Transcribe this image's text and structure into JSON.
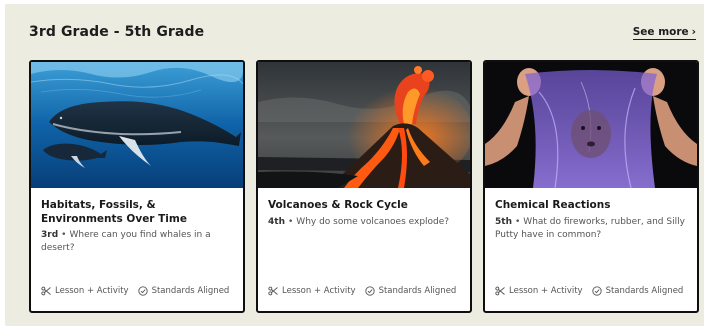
{
  "section": {
    "title": "3rd Grade - 5th Grade",
    "see_more_label": "See more",
    "see_more_icon": "chevron-right-icon"
  },
  "cards": [
    {
      "title": "Habitats, Fossils, & Environments Over Time",
      "grade": "3rd",
      "question": "Where can you find whales in a desert?",
      "image": "humpback-whales-underwater",
      "tags": [
        {
          "icon": "scissors-icon",
          "label": "Lesson + Activity"
        },
        {
          "icon": "check-circle-icon",
          "label": "Standards Aligned"
        }
      ]
    },
    {
      "title": "Volcanoes & Rock Cycle",
      "grade": "4th",
      "question": "Why do some volcanoes explode?",
      "image": "erupting-volcano",
      "tags": [
        {
          "icon": "scissors-icon",
          "label": "Lesson + Activity"
        },
        {
          "icon": "check-circle-icon",
          "label": "Standards Aligned"
        }
      ]
    },
    {
      "title": "Chemical Reactions",
      "grade": "5th",
      "question": "What do fireworks, rubber, and Silly Putty have in common?",
      "image": "stretched-purple-slime",
      "tags": [
        {
          "icon": "scissors-icon",
          "label": "Lesson + Activity"
        },
        {
          "icon": "check-circle-icon",
          "label": "Standards Aligned"
        }
      ]
    }
  ],
  "colors": {
    "panel_background": "#ecece0",
    "card_border": "#0f0f0f",
    "text_dark": "#1d1d1d",
    "text_muted": "#555555"
  }
}
